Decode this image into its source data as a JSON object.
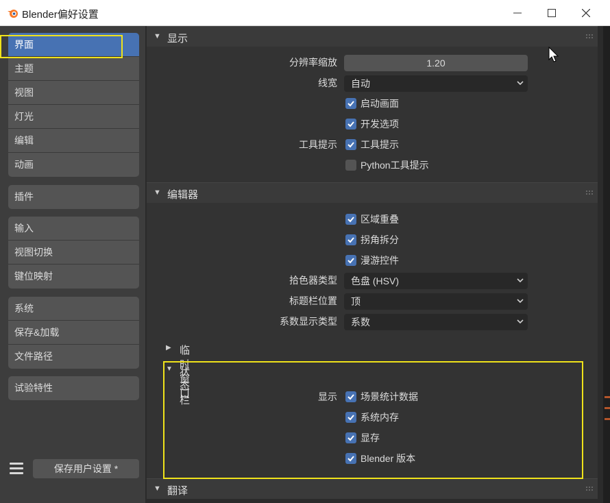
{
  "window": {
    "title": "Blender偏好设置"
  },
  "sidebar": {
    "groups": [
      [
        "界面",
        "主题",
        "视图",
        "灯光",
        "编辑",
        "动画"
      ],
      [
        "插件"
      ],
      [
        "输入",
        "视图切换",
        "键位映射"
      ],
      [
        "系统",
        "保存&加载",
        "文件路径"
      ],
      [
        "试验特性"
      ]
    ],
    "active": "界面",
    "save_button": "保存用户设置 *"
  },
  "display": {
    "title": "显示",
    "resolution_label": "分辨率缩放",
    "resolution_value": "1.20",
    "line_width_label": "线宽",
    "line_width_value": "自动",
    "splash": {
      "label": "启动画面",
      "checked": true
    },
    "dev_extras": {
      "label": "开发选项",
      "checked": true
    },
    "tooltips_label": "工具提示",
    "tooltips": {
      "label": "工具提示",
      "checked": true
    },
    "python_tooltips": {
      "label": "Python工具提示",
      "checked": false
    }
  },
  "editors": {
    "title": "编辑器",
    "region_overlap": {
      "label": "区域重叠",
      "checked": true
    },
    "corner_split": {
      "label": "拐角拆分",
      "checked": true
    },
    "navigation_controls": {
      "label": "漫游控件",
      "checked": true
    },
    "color_picker_label": "拾色器类型",
    "color_picker_value": "色盘 (HSV)",
    "header_position_label": "标题栏位置",
    "header_position_value": "顶",
    "factor_display_label": "系数显示类型",
    "factor_display_value": "系数",
    "temp_windows": "临时窗口",
    "status_bar": {
      "title": "状态栏",
      "show_label": "显示",
      "scene_stats": {
        "label": "场景统计数据",
        "checked": true
      },
      "system_memory": {
        "label": "系统内存",
        "checked": true
      },
      "video_memory": {
        "label": "显存",
        "checked": true
      },
      "blender_version": {
        "label": "Blender 版本",
        "checked": true
      }
    }
  },
  "translation": {
    "title": "翻译"
  },
  "colors": {
    "accent": "#4772b3",
    "highlight": "#f0e31a"
  }
}
